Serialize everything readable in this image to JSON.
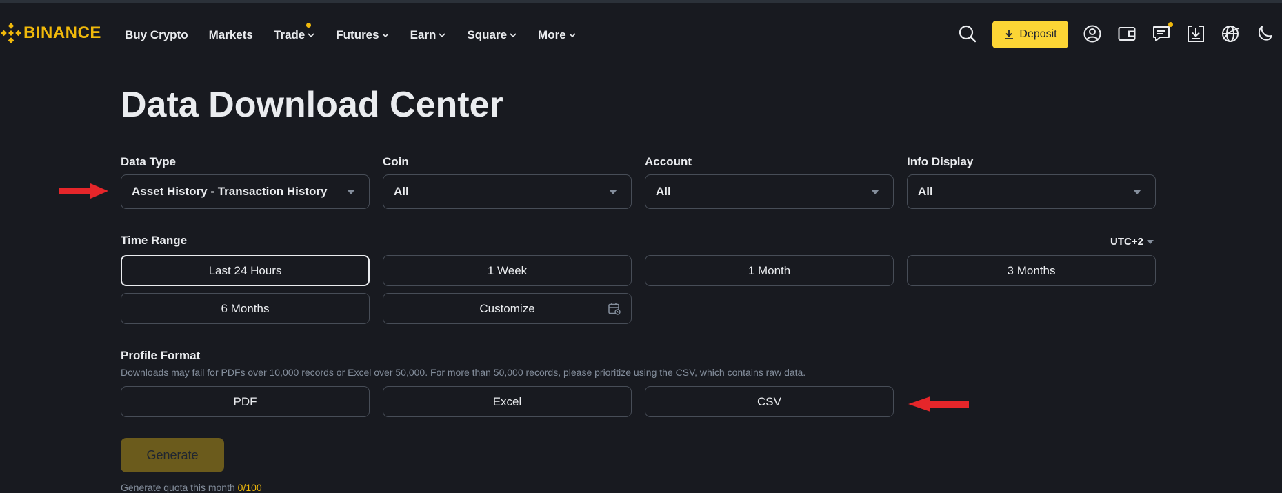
{
  "brand": {
    "name": "BINANCE",
    "color": "#f0b90b",
    "icon": "binance-logo-icon"
  },
  "nav": [
    {
      "label": "Buy Crypto",
      "dropdown": false,
      "dot": false
    },
    {
      "label": "Markets",
      "dropdown": false,
      "dot": false
    },
    {
      "label": "Trade",
      "dropdown": true,
      "dot": true
    },
    {
      "label": "Futures",
      "dropdown": true,
      "dot": false
    },
    {
      "label": "Earn",
      "dropdown": true,
      "dot": false
    },
    {
      "label": "Square",
      "dropdown": true,
      "dot": false
    },
    {
      "label": "More",
      "dropdown": true,
      "dot": false
    }
  ],
  "header": {
    "deposit_label": "Deposit",
    "icons": [
      "search-icon",
      "download-icon",
      "user-icon",
      "wallet-icon",
      "messages-icon",
      "app-download-icon",
      "globe-icon",
      "moon-icon"
    ]
  },
  "page": {
    "title": "Data Download Center",
    "filters": {
      "data_type": {
        "label": "Data Type",
        "value": "Asset History - Transaction History"
      },
      "coin": {
        "label": "Coin",
        "value": "All"
      },
      "account": {
        "label": "Account",
        "value": "All"
      },
      "info_display": {
        "label": "Info Display",
        "value": "All"
      }
    },
    "time_range": {
      "label": "Time Range",
      "timezone": "UTC+2",
      "options": [
        "Last 24 Hours",
        "1 Week",
        "1 Month",
        "3 Months",
        "6 Months",
        "Customize"
      ],
      "selected": "Last 24 Hours"
    },
    "profile_format": {
      "label": "Profile Format",
      "hint": "Downloads may fail for PDFs over 10,000 records or Excel over 50,000. For more than 50,000 records, please prioritize using the CSV, which contains raw data.",
      "options": [
        "PDF",
        "Excel",
        "CSV"
      ]
    },
    "generate_label": "Generate",
    "quota": {
      "text": "Generate quota this month",
      "value": "0/100"
    }
  },
  "colors": {
    "background": "#181a20",
    "accent": "#fcd535",
    "border": "#474d57",
    "muted": "#848e9c",
    "annotation_arrow": "#e5262a"
  }
}
